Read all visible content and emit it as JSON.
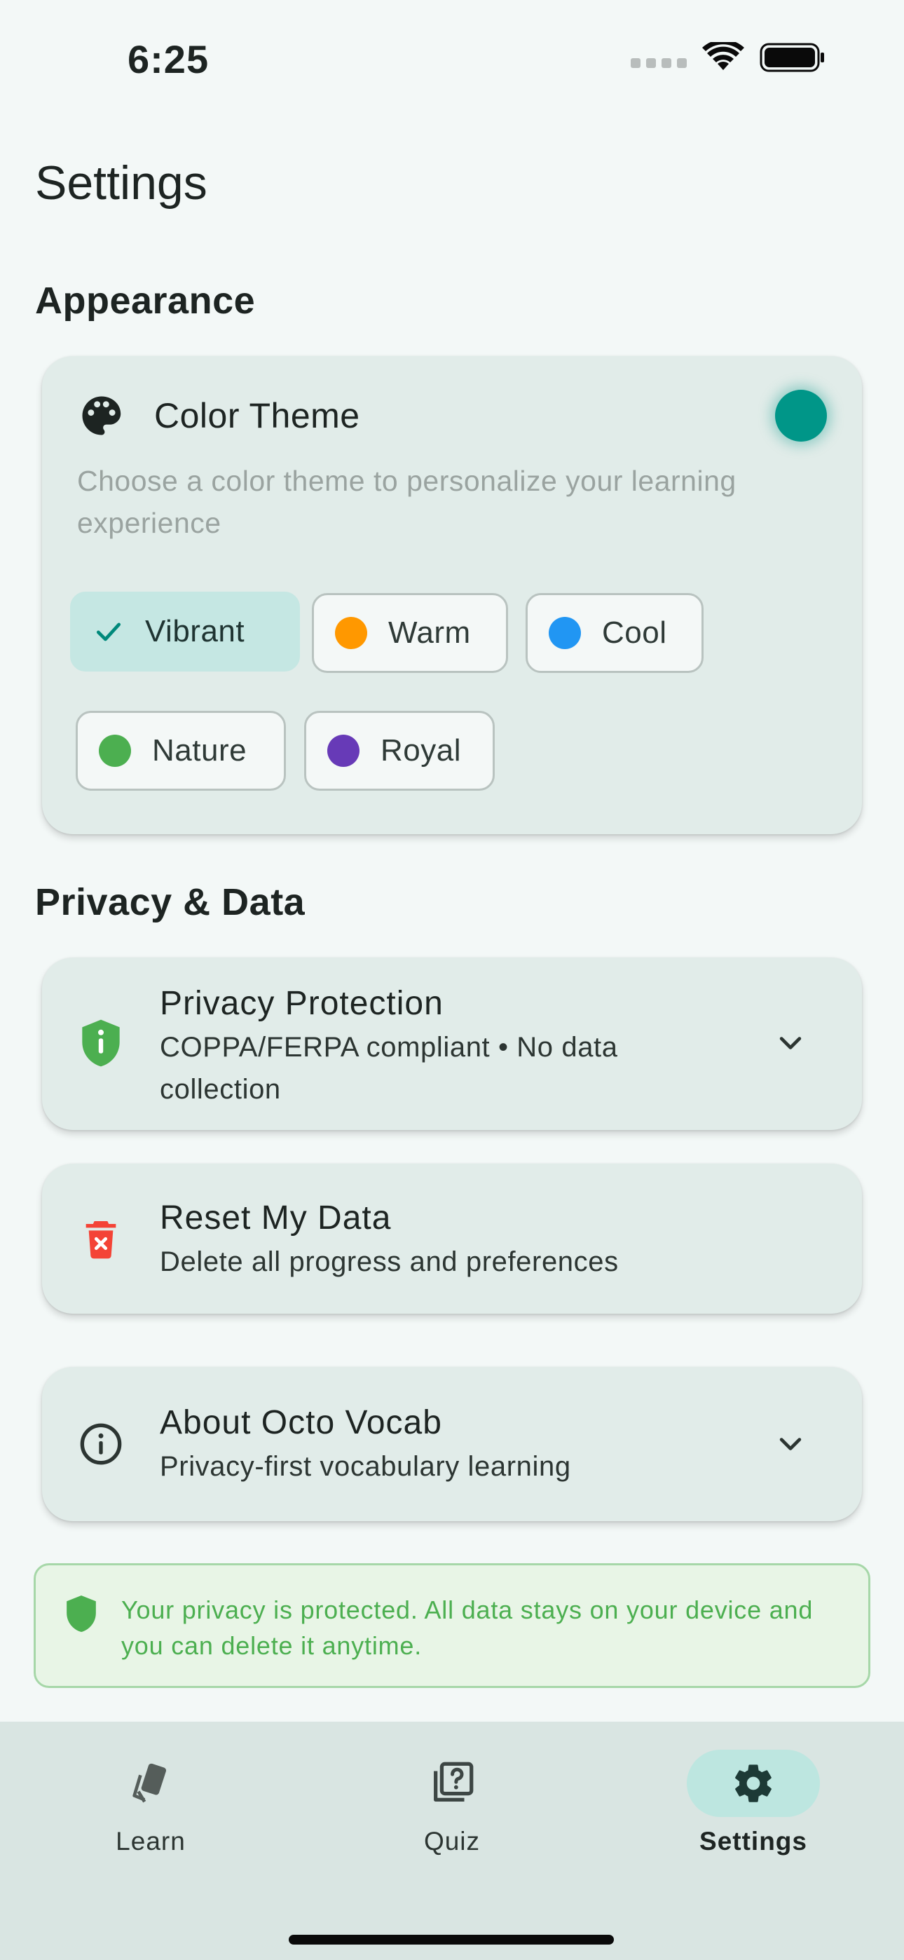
{
  "status_bar": {
    "time": "6:25"
  },
  "page_title": "Settings",
  "appearance": {
    "section_title": "Appearance",
    "theme_card": {
      "icon": "palette-icon",
      "title": "Color Theme",
      "description": "Choose a color theme to personalize your learning experience",
      "current_color": "#009688",
      "options": [
        {
          "label": "Vibrant",
          "selected": true
        },
        {
          "label": "Warm",
          "color": "#ff9800"
        },
        {
          "label": "Cool",
          "color": "#2196f3"
        },
        {
          "label": "Nature",
          "color": "#4caf50"
        },
        {
          "label": "Royal",
          "color": "#673ab7"
        }
      ]
    }
  },
  "privacy": {
    "section_title": "Privacy & Data",
    "items": [
      {
        "icon": "shield-info-icon",
        "title": "Privacy Protection",
        "subtitle": "COPPA/FERPA compliant • No data collection",
        "expandable": true
      },
      {
        "icon": "trash-icon",
        "title": "Reset My Data",
        "subtitle": "Delete all progress and preferences",
        "expandable": false
      },
      {
        "icon": "info-icon",
        "title": "About Octo Vocab",
        "subtitle": "Privacy-first vocabulary learning",
        "expandable": true
      }
    ],
    "banner": {
      "icon": "shield-icon",
      "text": "Your privacy is protected. All data stays on your device and you can delete it anytime."
    }
  },
  "bottom_nav": {
    "items": [
      {
        "label": "Learn",
        "icon": "cards-icon"
      },
      {
        "label": "Quiz",
        "icon": "quiz-icon"
      },
      {
        "label": "Settings",
        "icon": "gear-icon",
        "active": true
      }
    ]
  },
  "colors": {
    "accent": "#009688",
    "success": "#4caf50",
    "danger": "#f44336"
  }
}
